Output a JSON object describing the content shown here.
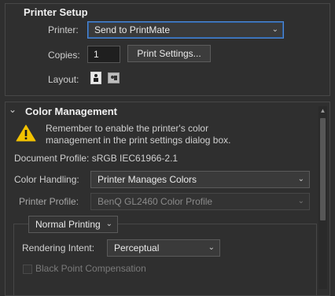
{
  "printer_setup": {
    "title": "Printer Setup",
    "printer_label": "Printer:",
    "printer_value": "Send to PrintMate",
    "copies_label": "Copies:",
    "copies_value": "1",
    "print_settings_button": "Print Settings...",
    "layout_label": "Layout:"
  },
  "color_management": {
    "title": "Color Management",
    "warning_line1": "Remember to enable the printer's color",
    "warning_line2": "management in the print settings dialog box.",
    "document_profile": "Document Profile: sRGB IEC61966-2.1",
    "color_handling_label": "Color Handling:",
    "color_handling_value": "Printer Manages Colors",
    "printer_profile_label": "Printer Profile:",
    "printer_profile_value": "BenQ GL2460 Color Profile",
    "normal_printing_value": "Normal Printing",
    "rendering_intent_label": "Rendering Intent:",
    "rendering_intent_value": "Perceptual",
    "black_point_label": "Black Point Compensation"
  },
  "colors": {
    "accent_focus": "#4d88d6",
    "warning_yellow": "#f2c200"
  },
  "icons": {
    "collapse": "chevron-down-icon",
    "warning": "warning-icon",
    "layout_portrait": "portrait-layout-icon",
    "layout_landscape": "landscape-layout-icon"
  }
}
